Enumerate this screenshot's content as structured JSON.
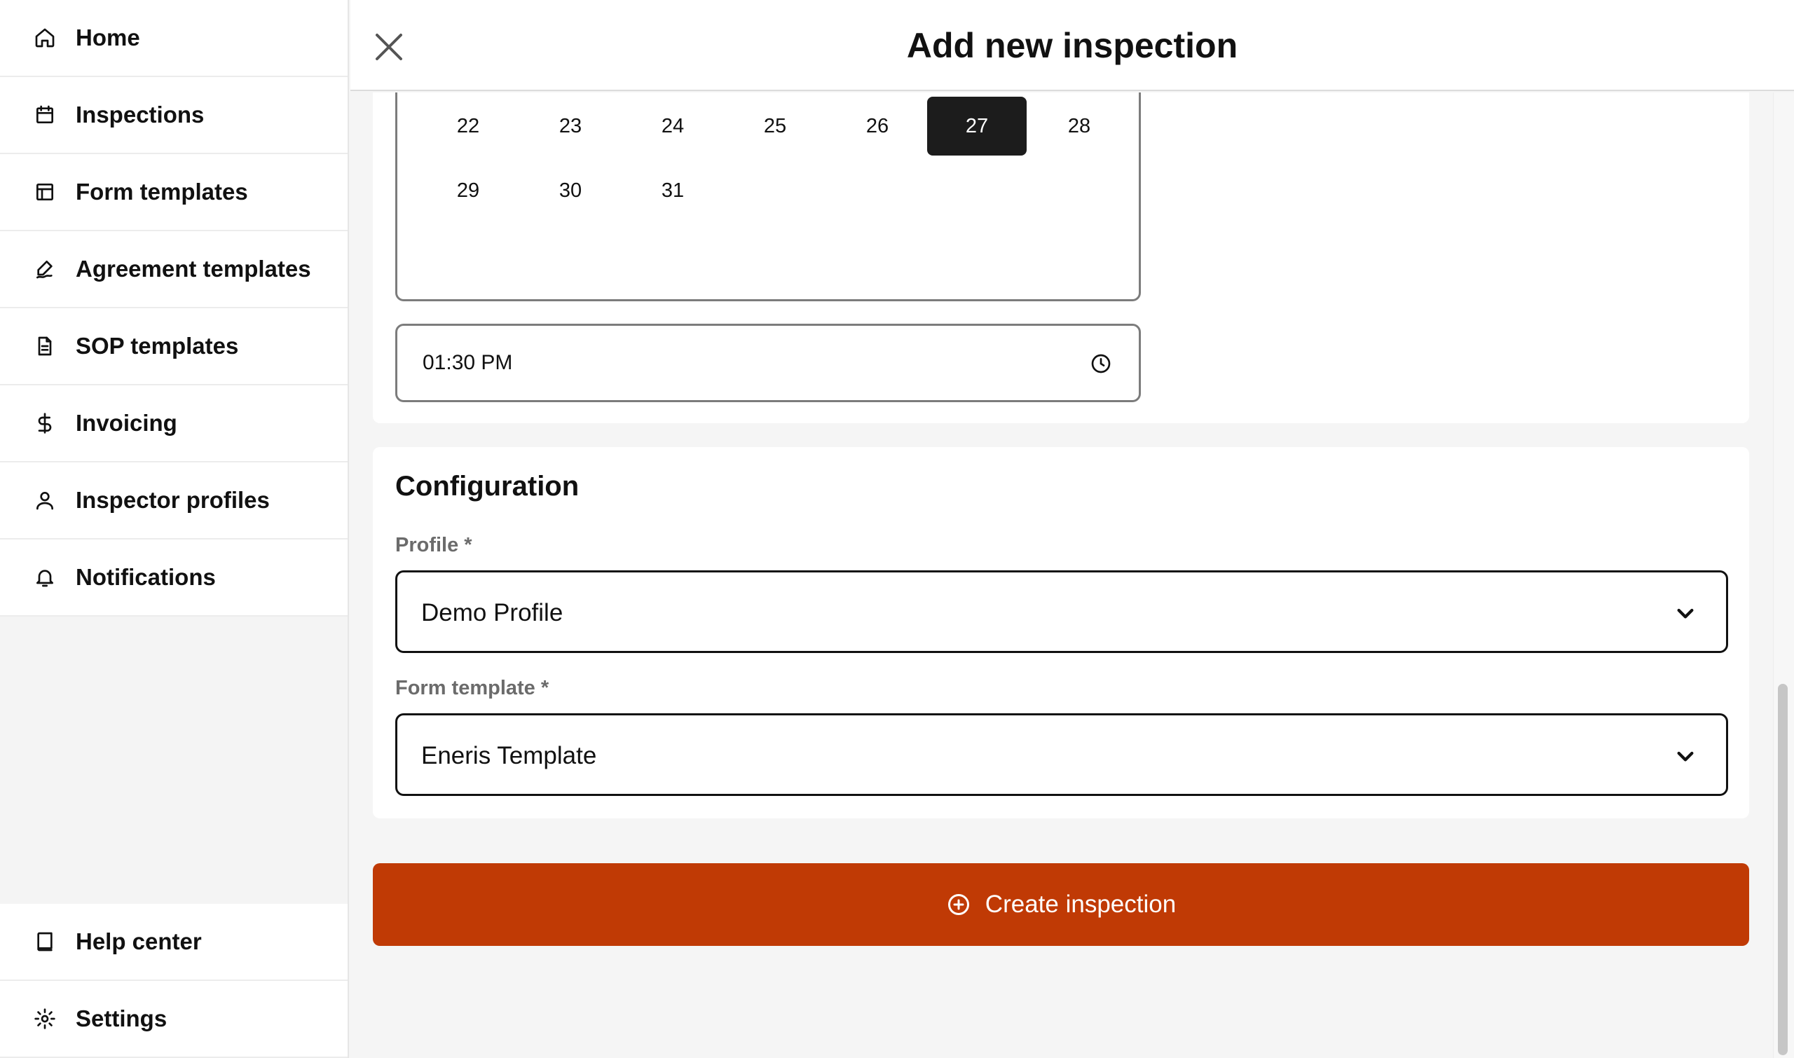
{
  "sidebar": {
    "top_items": [
      {
        "label": "Home",
        "icon": "home-icon"
      },
      {
        "label": "Inspections",
        "icon": "calendar-icon"
      },
      {
        "label": "Form templates",
        "icon": "layout-icon"
      },
      {
        "label": "Agreement templates",
        "icon": "signature-icon"
      },
      {
        "label": "SOP templates",
        "icon": "document-icon"
      },
      {
        "label": "Invoicing",
        "icon": "dollar-icon"
      },
      {
        "label": "Inspector profiles",
        "icon": "user-icon"
      },
      {
        "label": "Notifications",
        "icon": "bell-icon"
      }
    ],
    "bottom_items": [
      {
        "label": "Help center",
        "icon": "book-icon"
      },
      {
        "label": "Settings",
        "icon": "gear-icon"
      }
    ]
  },
  "header": {
    "title": "Add new inspection"
  },
  "date_picker": {
    "rows": [
      [
        "22",
        "23",
        "24",
        "25",
        "26",
        "27",
        "28"
      ],
      [
        "29",
        "30",
        "31"
      ]
    ],
    "selected_day": "27"
  },
  "time_field": {
    "value": "01:30  PM"
  },
  "configuration": {
    "title": "Configuration",
    "profile_label": "Profile *",
    "profile_value": "Demo Profile",
    "form_template_label": "Form template *",
    "form_template_value": "Eneris Template"
  },
  "actions": {
    "create_label": "Create inspection"
  },
  "colors": {
    "accent": "#c03a05",
    "selected_day_bg": "#1c1c1c"
  }
}
